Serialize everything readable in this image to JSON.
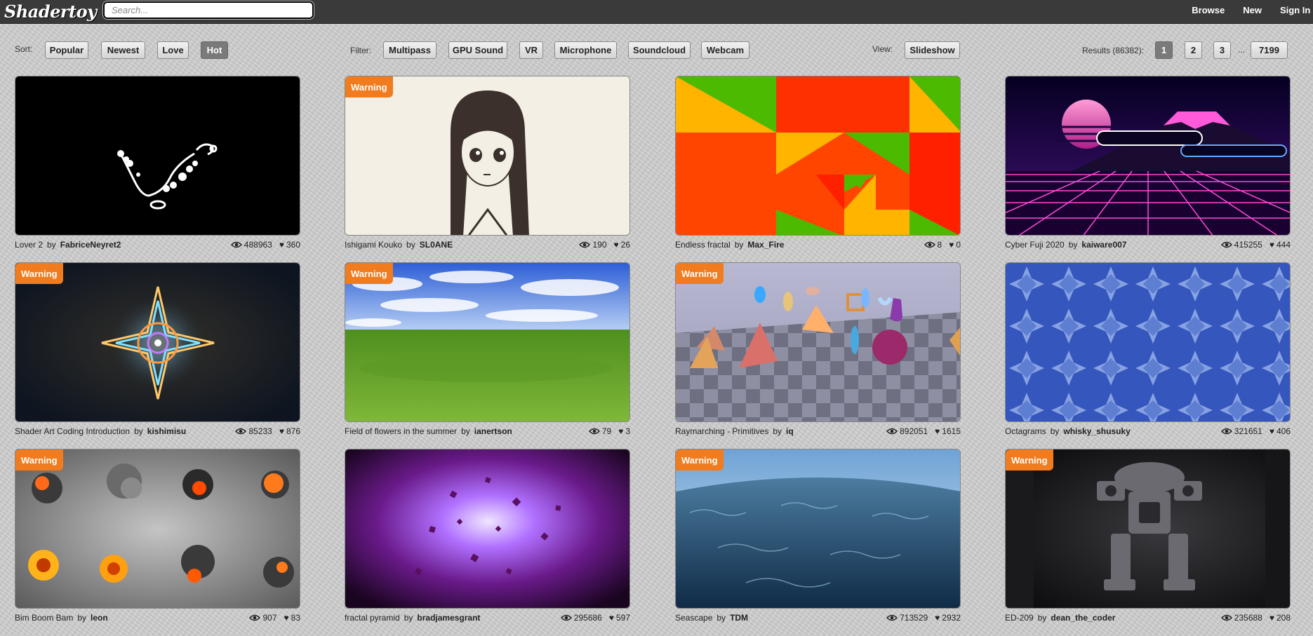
{
  "app": {
    "logo": "Shadertoy",
    "search_placeholder": "Search...",
    "nav": [
      "Browse",
      "New",
      "Sign In"
    ]
  },
  "toolbar": {
    "sort_label": "Sort:",
    "sort_options": [
      "Popular",
      "Newest",
      "Love",
      "Hot"
    ],
    "sort_active": "Hot",
    "filter_label": "Filter:",
    "filter_options": [
      "Multipass",
      "GPU Sound",
      "VR",
      "Microphone",
      "Soundcloud",
      "Webcam"
    ],
    "view_label": "View:",
    "view_option": "Slideshow",
    "results_label": "Results (86382):",
    "pages": [
      "1",
      "2",
      "3",
      "7199"
    ],
    "page_active": "1",
    "ellipsis": "..."
  },
  "shaders": [
    {
      "title": "Lover 2",
      "author": "FabriceNeyret2",
      "views": "488963",
      "likes": "360",
      "warning": "",
      "art": "lover"
    },
    {
      "title": "Ishigami Kouko",
      "author": "SL0ANE",
      "views": "190",
      "likes": "26",
      "warning": "Warning",
      "art": "anime"
    },
    {
      "title": "Endless fractal",
      "author": "Max_Fire",
      "views": "8",
      "likes": "0",
      "warning": "",
      "art": "fractal"
    },
    {
      "title": "Cyber Fuji 2020",
      "author": "kaiware007",
      "views": "415255",
      "likes": "444",
      "warning": "",
      "art": "cyber"
    },
    {
      "title": "Shader Art Coding Introduction",
      "author": "kishimisu",
      "views": "85233",
      "likes": "876",
      "warning": "Warning",
      "art": "shaderart"
    },
    {
      "title": "Field of flowers in the summer",
      "author": "ianertson",
      "views": "79",
      "likes": "3",
      "warning": "Warning",
      "art": "field"
    },
    {
      "title": "Raymarching - Primitives",
      "author": "iq",
      "views": "892051",
      "likes": "1615",
      "warning": "Warning",
      "art": "raymarch"
    },
    {
      "title": "Octagrams",
      "author": "whisky_shusuky",
      "views": "321651",
      "likes": "406",
      "warning": "",
      "art": "octagrams"
    },
    {
      "title": "Bim Boom Bam",
      "author": "leon",
      "views": "907",
      "likes": "83",
      "warning": "Warning",
      "art": "explosions"
    },
    {
      "title": "fractal pyramid",
      "author": "bradjamesgrant",
      "views": "295686",
      "likes": "597",
      "warning": "",
      "art": "pyramid"
    },
    {
      "title": "Seascape",
      "author": "TDM",
      "views": "713529",
      "likes": "2932",
      "warning": "Warning",
      "art": "seascape"
    },
    {
      "title": "ED-209",
      "author": "dean_the_coder",
      "views": "235688",
      "likes": "208",
      "warning": "Warning",
      "art": "ed209"
    }
  ],
  "by_word": "by",
  "colors": {
    "topbar": "#3a3a3a",
    "warning": "#f07c1f",
    "active_button": "#7a7a7a"
  }
}
